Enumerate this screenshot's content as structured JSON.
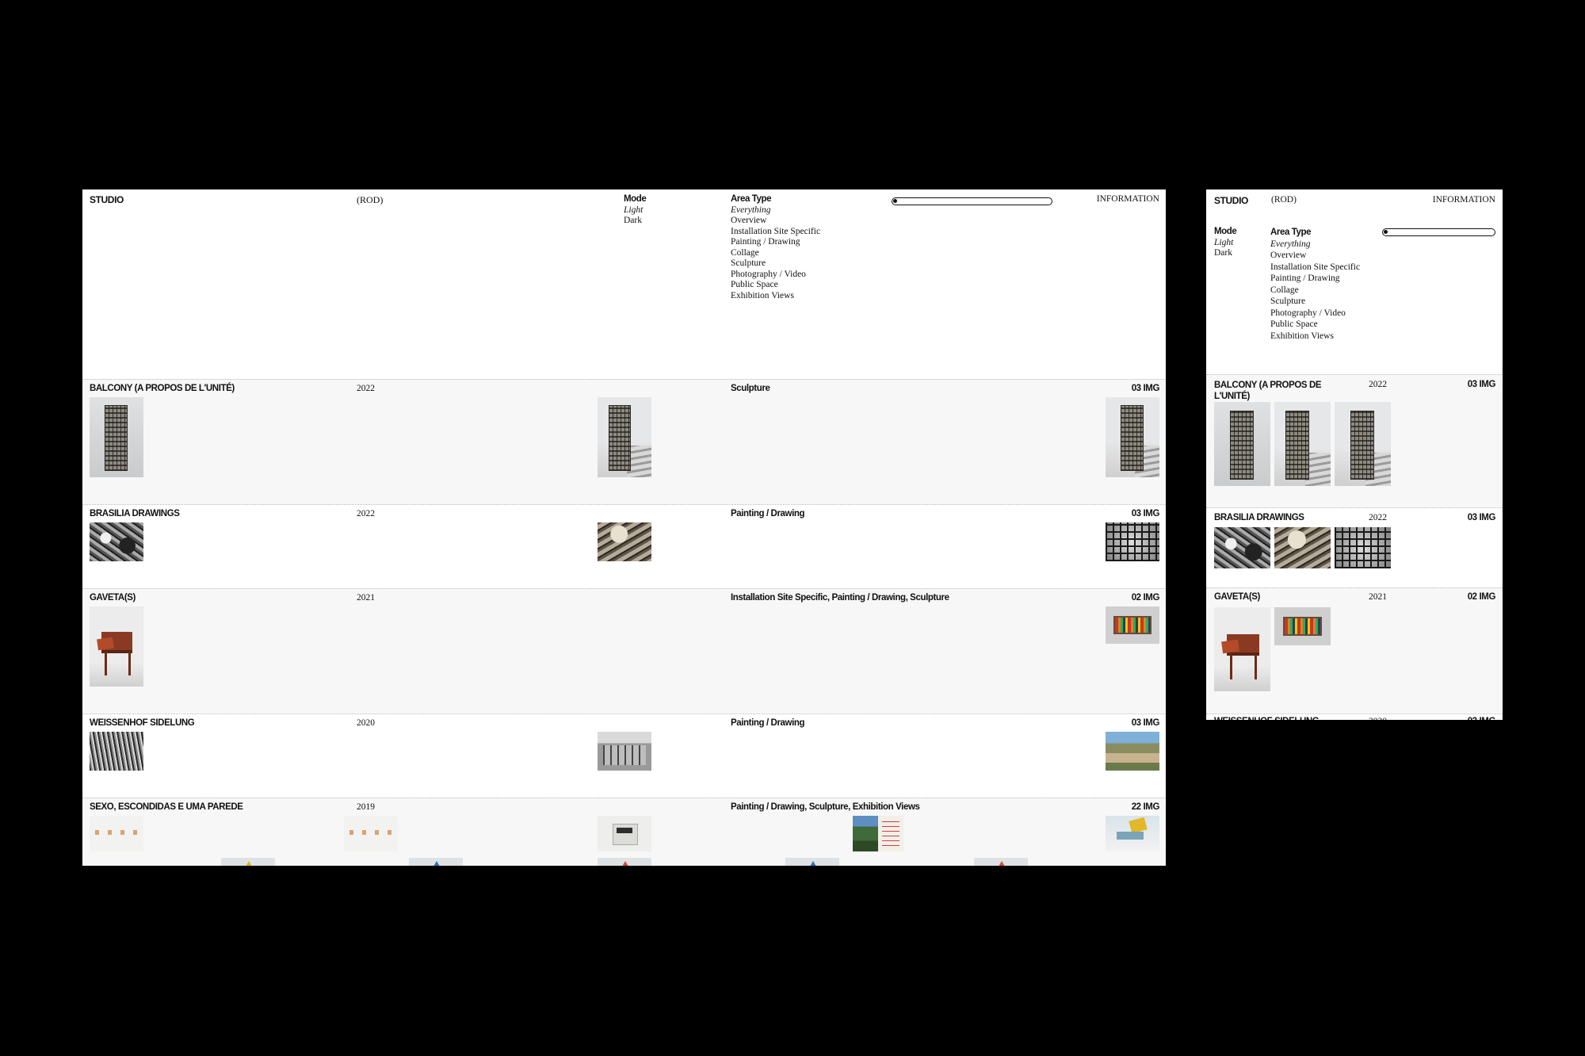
{
  "brand": "STUDIO",
  "artist": "(ROD)",
  "info_link": "INFORMATION",
  "mode": {
    "label": "Mode",
    "options": [
      "Light",
      "Dark"
    ],
    "selected": "Light"
  },
  "area": {
    "label": "Area Type",
    "options": [
      "Everything",
      "Overview",
      "Installation Site Specific",
      "Painting / Drawing",
      "Collage",
      "Sculpture",
      "Photography / Video",
      "Public Space",
      "Exhibition Views"
    ],
    "selected": "Everything"
  },
  "slider": {
    "value": 0
  },
  "projects": [
    {
      "title": "BALCONY (A PROPOS DE L'UNITÉ)",
      "mobile_title": "BALCONY (A PROPOS DE L'UNITÉ)",
      "year": "2022",
      "category": "Sculpture",
      "count": "03 IMG"
    },
    {
      "title": "BRASILIA DRAWINGS",
      "year": "2022",
      "category": "Painting / Drawing",
      "count": "03 IMG"
    },
    {
      "title": "GAVETA(S)",
      "year": "2021",
      "category": "Installation Site Specific, Painting / Drawing, Sculpture",
      "count": "02 IMG"
    },
    {
      "title": "WEISSENHOF SIDELUNG",
      "year": "2020",
      "category": "Painting / Drawing",
      "count": "03 IMG"
    },
    {
      "title": "SEXO, ESCONDIDAS E UMA PAREDE",
      "year": "2019",
      "category": "Painting / Drawing, Sculpture, Exhibition Views",
      "count": "22 IMG"
    }
  ],
  "colors": {
    "bg": "#000000",
    "screen": "#ffffff",
    "row_shade": "#f7f7f7",
    "ink": "#111111"
  }
}
